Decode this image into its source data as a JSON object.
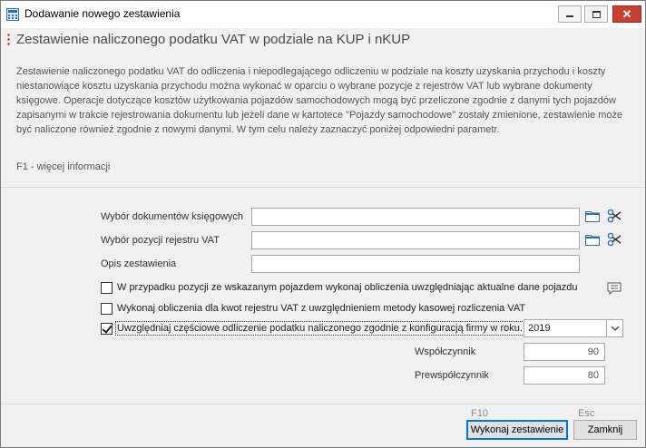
{
  "window": {
    "title": "Dodawanie nowego zestawienia"
  },
  "header": {
    "title": "Zestawienie naliczonego podatku VAT w podziale na KUP i nKUP",
    "description": "Zestawienie naliczonego podatku VAT do odliczenia i niepodlegającego odliczeniu w podziale na koszty uzyskania przychodu i koszty niestanowiące kosztu uzyskania przychodu można wykonać w oparciu o wybrane pozycje z rejestrów VAT lub wybrane dokumenty księgowe. Operacje dotyczące kosztów użytkowania pojazdów samochodowych mogą być przeliczone zgodnie z danymi tych pojazdów zapisanymi w trakcie rejestrowania dokumentu lub jeżeli dane w kartotece \"Pojazdy samochodowe\" zostały zmienione, zestawienie może być naliczone również zgodnie z nowymi danymi. W tym celu należy zaznaczyć poniżej odpowiedni parametr.",
    "help_hint": "F1 - więcej informacji"
  },
  "form": {
    "documents_label": "Wybór dokumentów księgowych",
    "documents_value": "",
    "vat_positions_label": "Wybór pozycji rejestru VAT",
    "vat_positions_value": "",
    "description_label": "Opis zestawienia",
    "description_value": "",
    "checkbox_vehicle": {
      "label": "W przypadku pozycji ze wskazanym pojazdem wykonaj obliczenia uwzględniając aktualne dane pojazdu",
      "checked": false
    },
    "checkbox_cash": {
      "label": "Wykonaj obliczenia dla kwot rejestru VAT z uwzględnieniem metody kasowej rozliczenia VAT",
      "checked": false
    },
    "checkbox_partial": {
      "label": "Uwzględniaj częściowe odliczenie podatku naliczonego zgodnie z konfiguracją firmy w roku...",
      "checked": true
    },
    "year_value": "2019",
    "coefficient_label": "Współczynnik",
    "coefficient_value": "90",
    "precoefficient_label": "Prewspółczynnik",
    "precoefficient_value": "80"
  },
  "footer": {
    "execute_key": "F10",
    "execute_label": "Wykonaj zestawienie",
    "close_key": "Esc",
    "close_label": "Zamknij"
  },
  "colors": {
    "close_button": "#c84031",
    "accent_dots": "#c0392b",
    "folder": "#2f6fb0",
    "primary_border": "#0078d7"
  },
  "icons": [
    "calculator-icon",
    "minimize-icon",
    "maximize-icon",
    "close-icon",
    "folder-icon",
    "scissors-icon",
    "comment-icon",
    "chevron-down-icon"
  ]
}
